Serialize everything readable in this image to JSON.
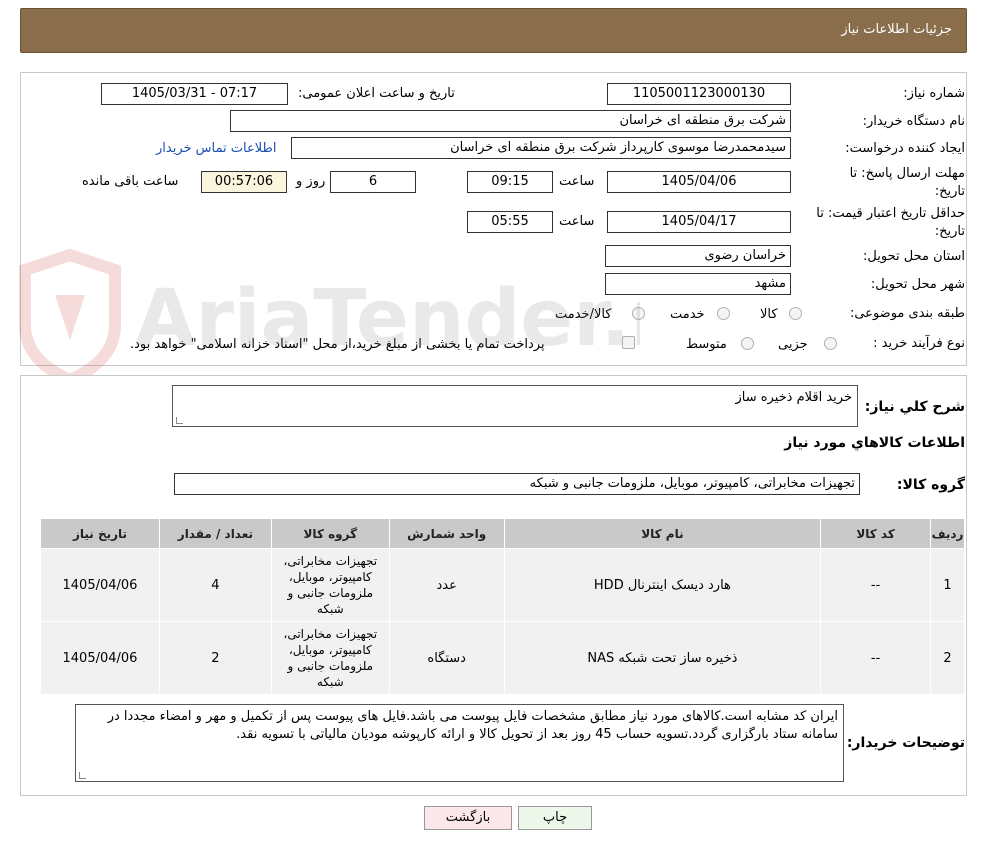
{
  "header": {
    "title": "جزئیات اطلاعات نیاز"
  },
  "form": {
    "need_number": {
      "label": "شماره نیاز:",
      "value": "1105001123000130"
    },
    "announce_datetime": {
      "label": "تاریخ و ساعت اعلان عمومی:",
      "value": "1405/03/31 - 07:17"
    },
    "buyer_org": {
      "label": "نام دستگاه خریدار:",
      "value": "شرکت برق منطقه ای خراسان"
    },
    "requester": {
      "label": "ایجاد کننده درخواست:",
      "value": "سیدمحمدرضا موسوی کارپرداز شرکت برق منطقه ای خراسان",
      "contact_link": "اطلاعات تماس خریدار"
    },
    "reply_deadline": {
      "label": "مهلت ارسال پاسخ: تا تاریخ:",
      "date": "1405/04/06",
      "time_label": "ساعت",
      "time": "09:15",
      "days": "6",
      "days_label": "روز و",
      "remaining": "00:57:06",
      "remaining_label": "ساعت باقی مانده"
    },
    "price_validity": {
      "label": "حداقل تاریخ اعتبار قیمت: تا تاریخ:",
      "date": "1405/04/17",
      "time_label": "ساعت",
      "time": "05:55"
    },
    "province": {
      "label": "استان محل تحویل:",
      "value": "خراسان رضوی"
    },
    "city": {
      "label": "شهر محل تحویل:",
      "value": "مشهد"
    },
    "category": {
      "label": "طبقه بندی موضوعی:",
      "options": [
        "کالا",
        "خدمت",
        "کالا/خدمت"
      ]
    },
    "process": {
      "label": "نوع فرآیند خرید :",
      "options": [
        "جزیی",
        "متوسط"
      ],
      "payment_note": "پرداخت تمام یا بخشی از مبلغ خرید،از محل \"اسناد خزانه اسلامی\" خواهد بود."
    }
  },
  "details": {
    "summary_label": "شرح کلي نياز:",
    "summary_value": "خرید اقلام ذخیره ساز",
    "items_heading": "اطلاعات کالاهاي مورد نياز",
    "group_label": "گروه کالا:",
    "group_value": "تجهیزات مخابراتی، کامپیوتر، موبایل، ملزومات جانبی و شبکه",
    "table": {
      "headers": [
        "رديف",
        "کد کالا",
        "نام کالا",
        "واحد شمارش",
        "گروه کالا",
        "تعداد / مقدار",
        "تاريخ نياز"
      ],
      "rows": [
        {
          "row": "1",
          "code": "--",
          "name": "هارد دیسک اینترنال HDD",
          "unit": "عدد",
          "group": "تجهیزات مخابراتی، کامپیوتر، موبایل، ملزومات جانبی و شبکه",
          "qty": "4",
          "date": "1405/04/06"
        },
        {
          "row": "2",
          "code": "--",
          "name": "ذخیره ساز تحت شبکه NAS",
          "unit": "دستگاه",
          "group": "تجهیزات مخابراتی، کامپیوتر، موبایل، ملزومات جانبی و شبکه",
          "qty": "2",
          "date": "1405/04/06"
        }
      ]
    },
    "buyer_notes_label": "توضیحات خریدار:",
    "buyer_notes": "ایران کد مشابه است.کالاهای مورد نیاز مطابق مشخصات فایل پیوست می باشد.فایل های پیوست پس از تکمیل و مهر و امضاء مجددا در سامانه ستاد بارگزاری گردد.تسویه حساب 45 روز بعد از تحویل کالا و ارائه کارپوشه مودیان مالیاتی با تسویه نقد."
  },
  "buttons": {
    "print": "چاپ",
    "back": "بازگشت"
  },
  "watermark": {
    "text": "AriaTender.neT"
  }
}
